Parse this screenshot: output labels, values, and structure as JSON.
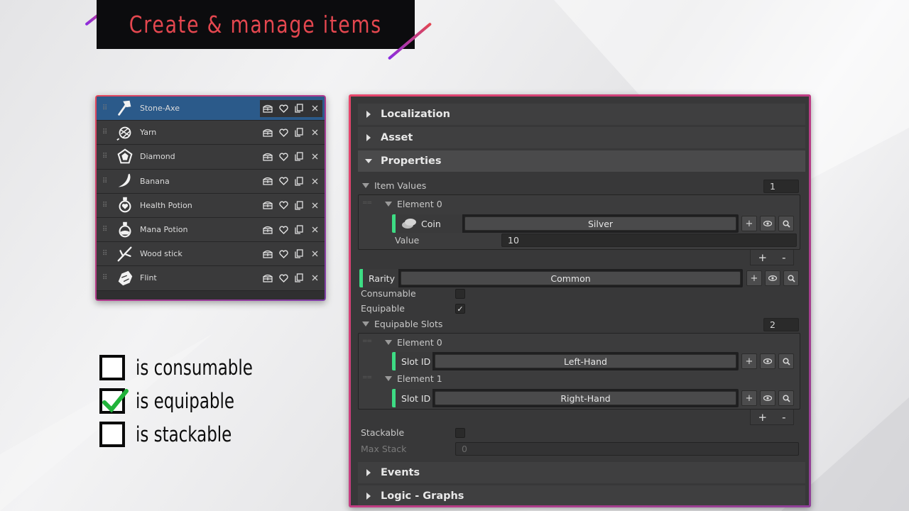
{
  "banner": {
    "title": "Create & manage items"
  },
  "items": [
    {
      "name": "Stone-Axe",
      "icon": "axe-icon",
      "selected": true
    },
    {
      "name": "Yarn",
      "icon": "yarn-icon",
      "selected": false
    },
    {
      "name": "Diamond",
      "icon": "diamond-icon",
      "selected": false
    },
    {
      "name": "Banana",
      "icon": "banana-icon",
      "selected": false
    },
    {
      "name": "Health Potion",
      "icon": "health-potion-icon",
      "selected": false
    },
    {
      "name": "Mana Potion",
      "icon": "mana-potion-icon",
      "selected": false
    },
    {
      "name": "Wood stick",
      "icon": "stick-icon",
      "selected": false
    },
    {
      "name": "Flint",
      "icon": "flint-icon",
      "selected": false
    }
  ],
  "checklist": [
    {
      "label": "is consumable",
      "checked": false
    },
    {
      "label": "is equipable",
      "checked": true
    },
    {
      "label": "is stackable",
      "checked": false
    }
  ],
  "inspector": {
    "sections": {
      "localization": "Localization",
      "asset": "Asset",
      "properties": "Properties",
      "events": "Events",
      "logic": "Logic - Graphs"
    },
    "item_values": {
      "label": "Item Values",
      "count": "1",
      "element0": {
        "label": "Element 0",
        "picker_label": "Coin",
        "picker_value": "Silver",
        "value_label": "Value",
        "value": "10"
      }
    },
    "rarity": {
      "label": "Rarity",
      "value": "Common"
    },
    "consumable": {
      "label": "Consumable",
      "checked": false
    },
    "equipable": {
      "label": "Equipable",
      "checked": true
    },
    "equipable_slots": {
      "label": "Equipable Slots",
      "count": "2",
      "element0": {
        "label": "Element 0",
        "picker_label": "Slot ID",
        "picker_value": "Left-Hand"
      },
      "element1": {
        "label": "Element 1",
        "picker_label": "Slot ID",
        "picker_value": "Right-Hand"
      }
    },
    "stackable": {
      "label": "Stackable",
      "checked": false
    },
    "max_stack": {
      "label": "Max Stack",
      "value": "0"
    },
    "plus": "+",
    "minus": "-"
  },
  "colors": {
    "accent_green": "#3ddc84",
    "banner_text": "#e4474f",
    "selection": "#2b5a8a"
  }
}
